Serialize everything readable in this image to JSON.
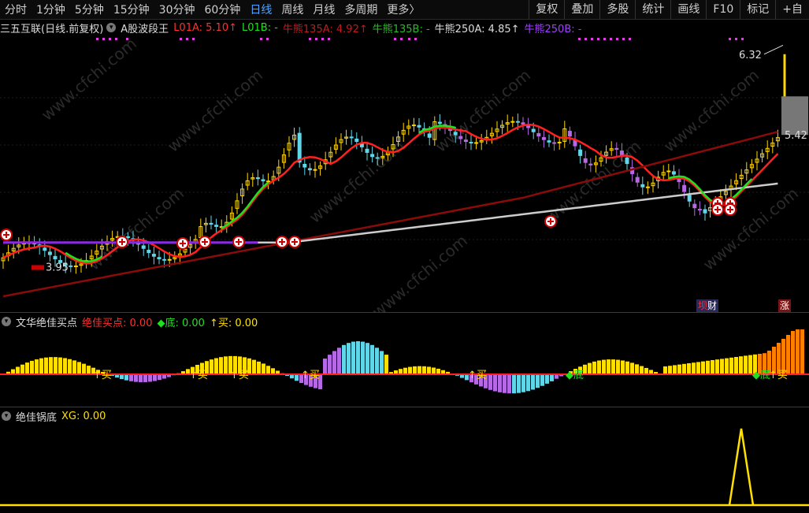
{
  "toolbar": {
    "periods": [
      "分时",
      "1分钟",
      "5分钟",
      "15分钟",
      "30分钟",
      "60分钟",
      "日线",
      "周线",
      "月线",
      "多周期",
      "更多〉"
    ],
    "active_period": "日线",
    "right_buttons": [
      "复权",
      "叠加",
      "多股",
      "统计",
      "画线",
      "F10",
      "标记",
      "+自"
    ]
  },
  "main_panel": {
    "stock": "三五互联(日线.前复权)",
    "indicator": "A股波段王",
    "l01a": "L01A: 5.10↑",
    "l01b": "L01B: -",
    "nx135a": "牛熊135A: 4.92↑",
    "nx135b": "牛熊135B: -",
    "nx250a": "牛熊250A: 4.85↑",
    "nx250b": "牛熊250B: -",
    "high_label": "6.32",
    "last_price": "5.42",
    "low_label": "3.95",
    "tag_cai": "财",
    "tag_zhang": "涨"
  },
  "indicator1": {
    "title": "文华绝佳买点",
    "jiajia": "绝佳买点: 0.00",
    "di": "◆底: 0.00",
    "mai": "↑买: 0.00",
    "buy_text": "↑买",
    "di_text": "◆底"
  },
  "indicator2": {
    "title": "绝佳锅底",
    "xg": "XG: 0.00"
  },
  "watermark": "www.cfchi.com",
  "colors": {
    "up": "#ffd700",
    "down": "#5fd7e8",
    "magenta": "#b768e6",
    "red_line": "#ff2020",
    "green_line": "#20e020",
    "purple_line": "#8a2be2",
    "white_line": "#cccccc",
    "maroon_line": "#8b0a0a",
    "orange": "#ff7f00",
    "yellow": "#ffe000"
  }
}
